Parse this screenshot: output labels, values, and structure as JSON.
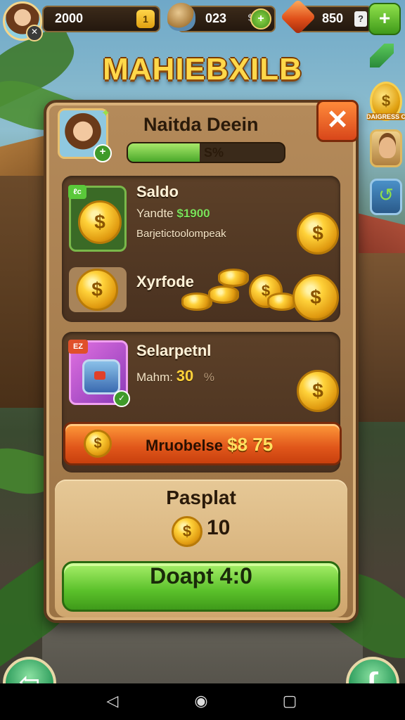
{
  "hud": {
    "currency1": "2000",
    "currency1_plus": "1",
    "currency2": "023",
    "currency2_sep": "$",
    "currency2_plus": "+",
    "currency3": "850",
    "currency3_help": "?",
    "add_button": "+"
  },
  "title": "MAHIEBXILB",
  "side": {
    "coin_symbol": "$",
    "coin_label": "DAIGRESS C"
  },
  "panel": {
    "player_name": "Naitda Deein",
    "progress_text": "S%",
    "progress_value": 0.46,
    "close_label": "✕",
    "offer1": {
      "tag": "ℓc",
      "title": "Saldo",
      "line1_label": "Yandte",
      "line1_value": "$1900",
      "line2": "Barjetictoolompeak",
      "line3": "Xyrfode",
      "coin_symbol": "$"
    },
    "offer2": {
      "tag": "EZ",
      "title": "Selarpetnl",
      "line1_label": "Mahm:",
      "line1_value": "30",
      "line1_suffix": "%",
      "coin_symbol": "$"
    },
    "buy_button": {
      "label": "Mruobelse",
      "price": "$8 75",
      "coin_symbol": "$"
    },
    "payout": {
      "title": "Pasplat",
      "amount": "10",
      "coin_symbol": "$"
    },
    "accept_button": "Doapt 4:0"
  },
  "bottom": {
    "back_icon": "⇦",
    "chat_icon": "ʃ"
  },
  "navbar": {
    "back": "◁",
    "home": "◉",
    "recent": "▢"
  },
  "colors": {
    "title_gold": "#ffd84a",
    "accept_green": "#5ac02a",
    "buy_orange": "#e0561a",
    "close_orange": "#d8461a",
    "panel_tan": "#b48a5a"
  }
}
